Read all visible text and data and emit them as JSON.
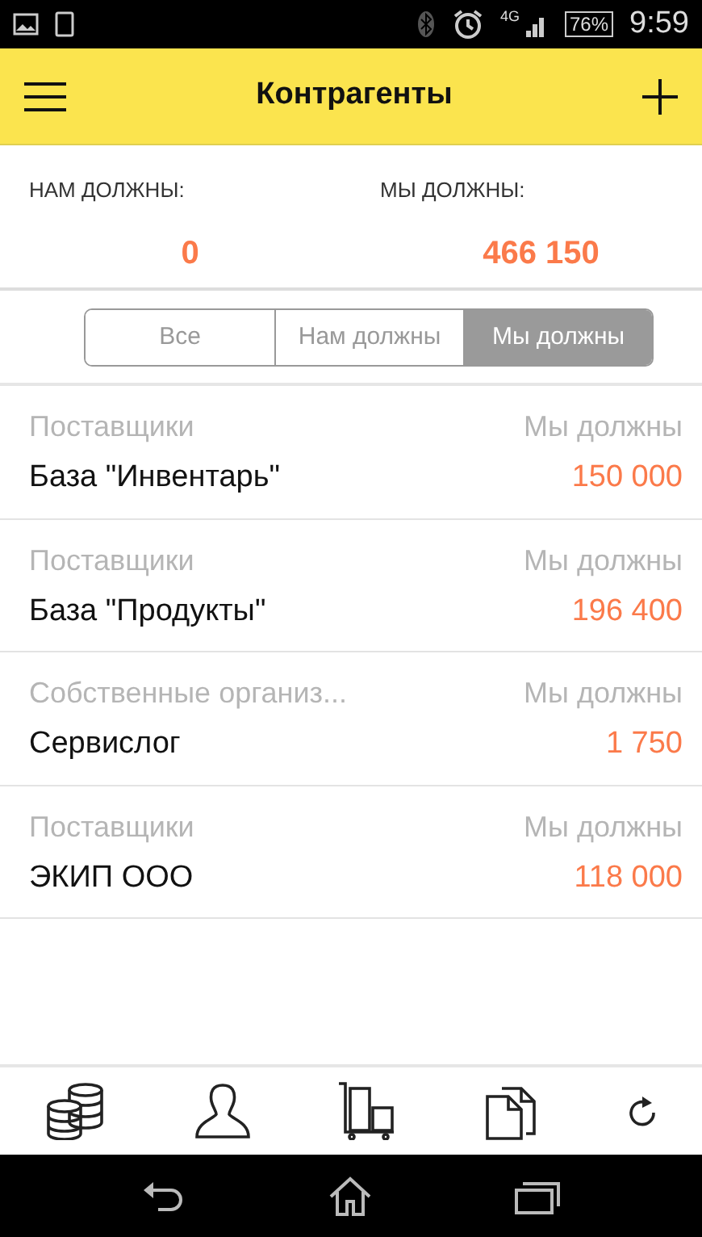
{
  "status_bar": {
    "network": "4G",
    "battery": "76%",
    "time": "9:59"
  },
  "header": {
    "title": "Контрагенты"
  },
  "summary": [
    {
      "label": "НАМ ДОЛЖНЫ:",
      "value": "0"
    },
    {
      "label": "МЫ ДОЛЖНЫ:",
      "value": "466 150"
    }
  ],
  "filters": [
    {
      "label": "Все",
      "selected": false
    },
    {
      "label": "Нам должны",
      "selected": false
    },
    {
      "label": "Мы должны",
      "selected": true
    }
  ],
  "rows": [
    {
      "group": "Поставщики",
      "status": "Мы должны",
      "name": "База \"Инвентарь\"",
      "amount": "150 000"
    },
    {
      "group": "Поставщики",
      "status": "Мы должны",
      "name": "База \"Продукты\"",
      "amount": "196 400"
    },
    {
      "group": "Собственные организ...",
      "status": "Мы должны",
      "name": "Сервислог",
      "amount": "1 750"
    },
    {
      "group": "Поставщики",
      "status": "Мы должны",
      "name": "ЭКИП ООО",
      "amount": "118 000"
    }
  ],
  "toolbar": [
    {
      "kind": "coins"
    },
    {
      "kind": "person"
    },
    {
      "kind": "cart"
    },
    {
      "kind": "documents"
    },
    {
      "kind": "refresh"
    }
  ]
}
